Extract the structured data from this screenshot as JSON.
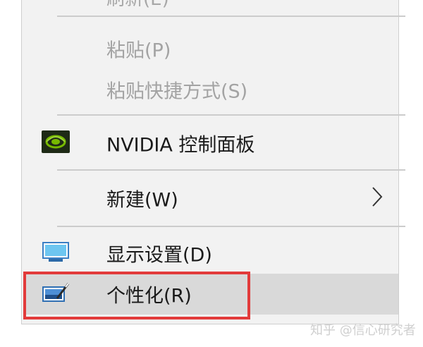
{
  "menu": {
    "clipped_top_text": "刷新(E)",
    "paste": {
      "label": "粘贴(P)",
      "enabled": false
    },
    "paste_shortcut": {
      "label": "粘贴快捷方式(S)",
      "enabled": false
    },
    "nvidia": {
      "label": "NVIDIA 控制面板",
      "icon": "nvidia-logo-icon"
    },
    "new": {
      "label": "新建(W)",
      "submenu_icon": "chevron-right-icon"
    },
    "display": {
      "label": "显示设置(D)",
      "icon": "monitor-icon"
    },
    "personalize": {
      "label": "个性化(R)",
      "icon": "personalize-icon",
      "highlighted": true
    }
  },
  "annotation": {
    "color": "#e23b3b"
  },
  "watermark": "知乎 @信心研究者"
}
